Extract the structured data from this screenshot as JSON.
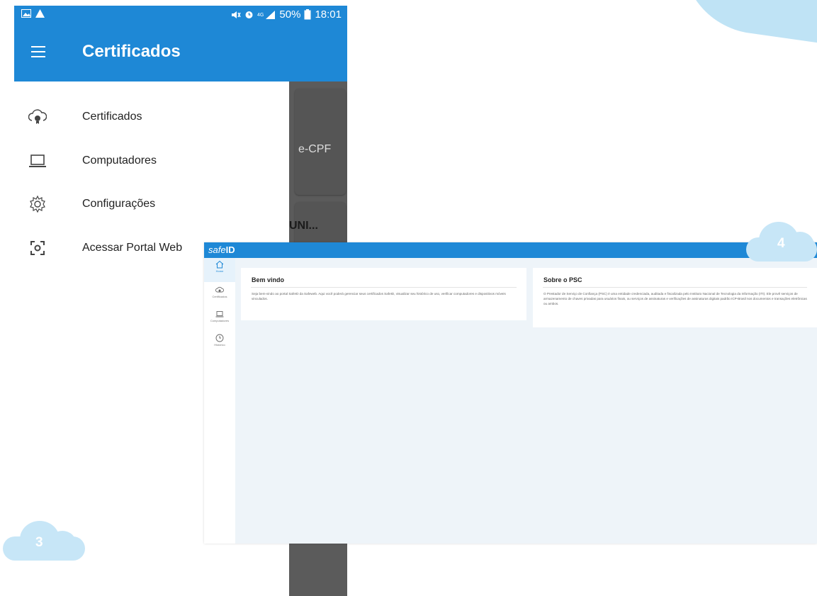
{
  "phone": {
    "status": {
      "battery": "50%",
      "time": "18:01"
    },
    "appbar_title": "Certificados",
    "drawer": [
      {
        "label": "Certificados",
        "icon": "cloud-certificate-icon"
      },
      {
        "label": "Computadores",
        "icon": "laptop-icon"
      },
      {
        "label": "Configurações",
        "icon": "gear-icon"
      },
      {
        "label": "Acessar Portal Web",
        "icon": "scan-icon"
      }
    ],
    "background_cards": {
      "card1": "e-CPF",
      "card2": "UNI..."
    }
  },
  "web": {
    "logo": {
      "part1": "safe",
      "part2": "ID"
    },
    "sidebar": [
      {
        "label": "Home",
        "icon": "home-icon"
      },
      {
        "label": "Certificados",
        "icon": "cloud-icon"
      },
      {
        "label": "Computadores",
        "icon": "laptop-icon"
      },
      {
        "label": "Histórico",
        "icon": "clock-icon"
      }
    ],
    "welcome_card": {
      "title": "Bem vindo",
      "text": "Seja bem-vindo ao portal SafeID da Safeweb. Aqui você poderá gerenciar seus certificados SafeID, visualizar seu histórico de uso, verificar computadores e dispositivos móveis vinculados."
    },
    "psc_card": {
      "title": "Sobre o PSC",
      "text": "O Prestador de Serviço de Confiança (PSC) é uma entidade credenciada, auditada e fiscalizada pelo Instituto Nacional de Tecnologia da Informação (ITI). Ele provê serviços de armazenamento de chaves privadas para usuários finais, ou serviços de assinaturas e verificações de assinaturas digitais padrão ICP-Brasil nos documentos e transações eletrônicas ou ambos."
    }
  },
  "steps": {
    "left": "3",
    "right": "4"
  },
  "colors": {
    "primary_blue": "#1e88d6",
    "cloud": "#c7e6f7",
    "dark_overlay": "#5b5b5b"
  }
}
